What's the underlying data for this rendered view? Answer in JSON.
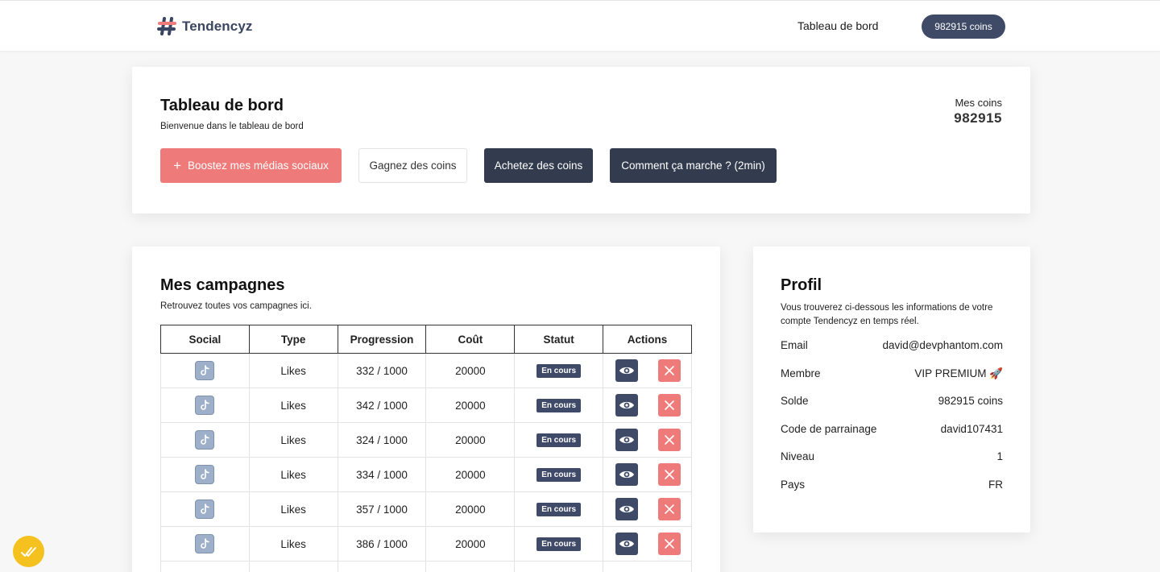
{
  "header": {
    "brand": "Tendencyz",
    "nav_dashboard": "Tableau de bord",
    "coins_pill": "982915 coins"
  },
  "dashboard": {
    "title": "Tableau de bord",
    "subtitle": "Bienvenue dans le tableau de bord",
    "my_coins_label": "Mes coins",
    "my_coins_value": "982915",
    "buttons": {
      "boost": "Boostez mes médias sociaux",
      "earn": "Gagnez des coins",
      "buy": "Achetez des coins",
      "how": "Comment ça marche ? (2min)"
    }
  },
  "campaigns": {
    "title": "Mes campagnes",
    "subtitle": "Retrouvez toutes vos campagnes ici.",
    "columns": [
      "Social",
      "Type",
      "Progression",
      "Coût",
      "Statut",
      "Actions"
    ],
    "rows": [
      {
        "social": "tiktok-icon",
        "type": "Likes",
        "progress": "332 / 1000",
        "cost": "20000",
        "status": "En cours"
      },
      {
        "social": "tiktok-icon",
        "type": "Likes",
        "progress": "342 / 1000",
        "cost": "20000",
        "status": "En cours"
      },
      {
        "social": "tiktok-icon",
        "type": "Likes",
        "progress": "324 / 1000",
        "cost": "20000",
        "status": "En cours"
      },
      {
        "social": "tiktok-icon",
        "type": "Likes",
        "progress": "334 / 1000",
        "cost": "20000",
        "status": "En cours"
      },
      {
        "social": "tiktok-icon",
        "type": "Likes",
        "progress": "357 / 1000",
        "cost": "20000",
        "status": "En cours"
      },
      {
        "social": "tiktok-icon",
        "type": "Likes",
        "progress": "386 / 1000",
        "cost": "20000",
        "status": "En cours"
      }
    ]
  },
  "profile": {
    "title": "Profil",
    "description": "Vous trouverez ci-dessous les informations de votre compte Tendencyz en temps réel.",
    "fields": [
      {
        "label": "Email",
        "value": "david@devphantom.com"
      },
      {
        "label": "Membre",
        "value": "VIP PREMIUM 🚀"
      },
      {
        "label": "Solde",
        "value": "982915 coins"
      },
      {
        "label": "Code de parrainage",
        "value": "david107431"
      },
      {
        "label": "Niveau",
        "value": "1"
      },
      {
        "label": "Pays",
        "value": "FR"
      }
    ]
  },
  "colors": {
    "accent_red": "#ee7b79",
    "dark_navy": "#333c4f",
    "badge_navy": "#3f4a68",
    "fab_yellow": "#f5c11e"
  }
}
